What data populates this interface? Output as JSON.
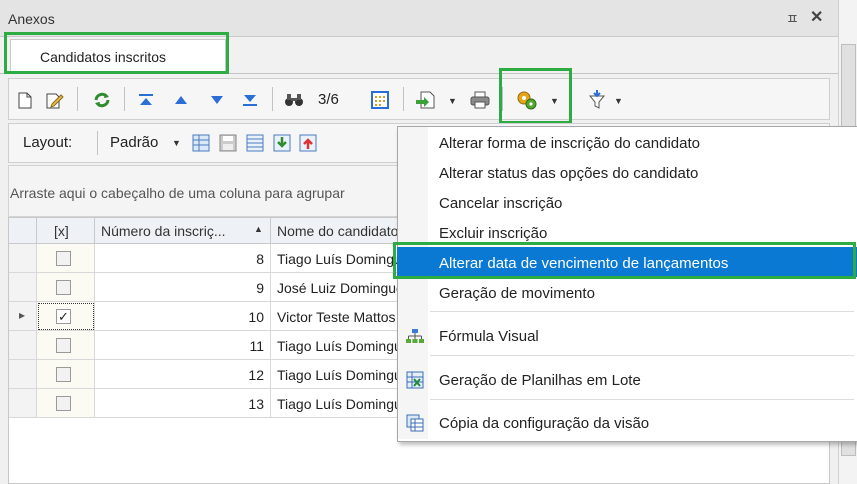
{
  "panel": {
    "title": "Anexos",
    "pin_glyph": "ᵖ",
    "close_glyph": "✕"
  },
  "tab": {
    "label": "Candidatos inscritos"
  },
  "toolbar": {
    "record_counter": "3/6",
    "layout_label": "Layout:",
    "layout_value": "Padrão"
  },
  "group_hint": "Arraste aqui o cabeçalho de uma coluna para agrupar",
  "grid": {
    "columns": {
      "check": "[x]",
      "number": "Número da inscriç...",
      "name": "Nome do candidato"
    },
    "rows": [
      {
        "number": "8",
        "name": "Tiago Luís Domingues",
        "checked": false,
        "current": false
      },
      {
        "number": "9",
        "name": "José Luiz Domingues",
        "checked": false,
        "current": false
      },
      {
        "number": "10",
        "name": "Victor Teste Mattos",
        "checked": true,
        "current": true
      },
      {
        "number": "11",
        "name": "Tiago Luís Domingues",
        "checked": false,
        "current": false
      },
      {
        "number": "12",
        "name": "Tiago Luís Domingues",
        "checked": false,
        "current": false
      },
      {
        "number": "13",
        "name": "Tiago Luís Domingues",
        "checked": false,
        "current": false
      }
    ]
  },
  "menu": {
    "items": [
      {
        "label": "Alterar forma de inscrição do candidato",
        "icon": ""
      },
      {
        "label": "Alterar status das opções do candidato",
        "icon": ""
      },
      {
        "label": "Cancelar inscrição",
        "icon": ""
      },
      {
        "label": "Excluir inscrição",
        "icon": ""
      },
      {
        "label": "Alterar data de vencimento de lançamentos",
        "icon": "",
        "selected": true
      },
      {
        "label": "Geração de movimento",
        "icon": ""
      },
      {
        "label": "Fórmula Visual",
        "icon": "hierarchy-icon"
      },
      {
        "label": "Geração de Planilhas em Lote",
        "icon": "spreadsheet-icon"
      },
      {
        "label": "Cópia da configuração da visão",
        "icon": "copy-view-icon"
      }
    ]
  },
  "colors": {
    "highlight": "#2eab43",
    "selection": "#0a79d4",
    "arrow_blue": "#2b6fd6"
  }
}
